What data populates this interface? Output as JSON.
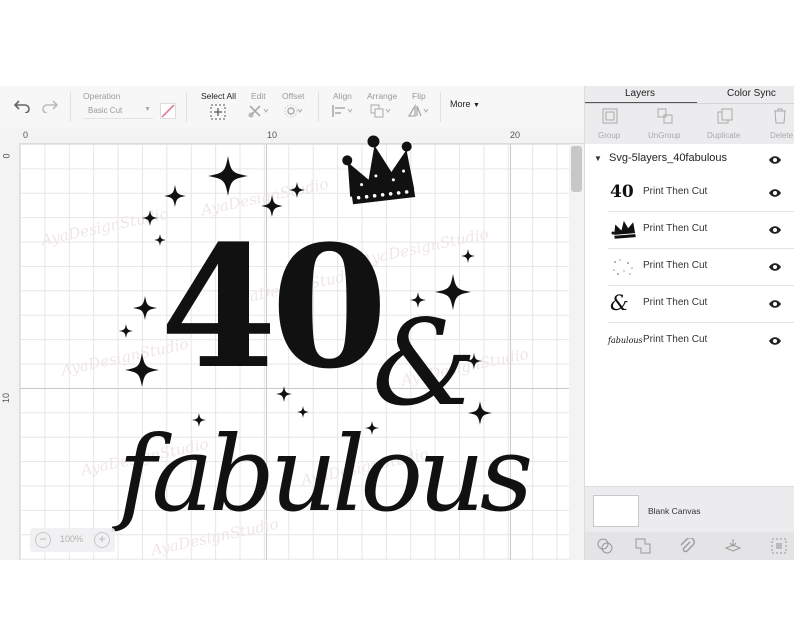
{
  "toolbar": {
    "undo_icon": "undo-icon",
    "redo_icon": "redo-icon",
    "operation_label": "Operation",
    "operation_value": "Basic Cut",
    "select_all_label": "Select All",
    "edit_label": "Edit",
    "offset_label": "Offset",
    "align_label": "Align",
    "arrange_label": "Arrange",
    "flip_label": "Flip",
    "more_label": "More"
  },
  "canvas": {
    "ruler_top": [
      "0",
      "10",
      "20"
    ],
    "ruler_left": [
      "0",
      "10"
    ],
    "zoom_minus": "−",
    "zoom_value": "100%",
    "zoom_plus": "+",
    "watermark": "AyaDesignStudio"
  },
  "design": {
    "number": "40",
    "ampersand": "&",
    "word": "fabulous"
  },
  "panel": {
    "tabs": [
      "Layers",
      "Color Sync"
    ],
    "tools": [
      "Group",
      "UnGroup",
      "Duplicate",
      "Delete"
    ],
    "group_name": "Svg-5layers_40fabulous",
    "layers": [
      {
        "thumb": "40",
        "label": "Print Then Cut"
      },
      {
        "thumb": "crown",
        "label": "Print Then Cut"
      },
      {
        "thumb": "stars",
        "label": "Print Then Cut"
      },
      {
        "thumb": "&",
        "label": "Print Then Cut"
      },
      {
        "thumb": "fabulous",
        "label": "Print Then Cut"
      }
    ],
    "blank_canvas_label": "Blank Canvas"
  },
  "colors": {
    "accent": "#555555",
    "design_ink": "#111111",
    "panel_bg": "#ececee"
  }
}
